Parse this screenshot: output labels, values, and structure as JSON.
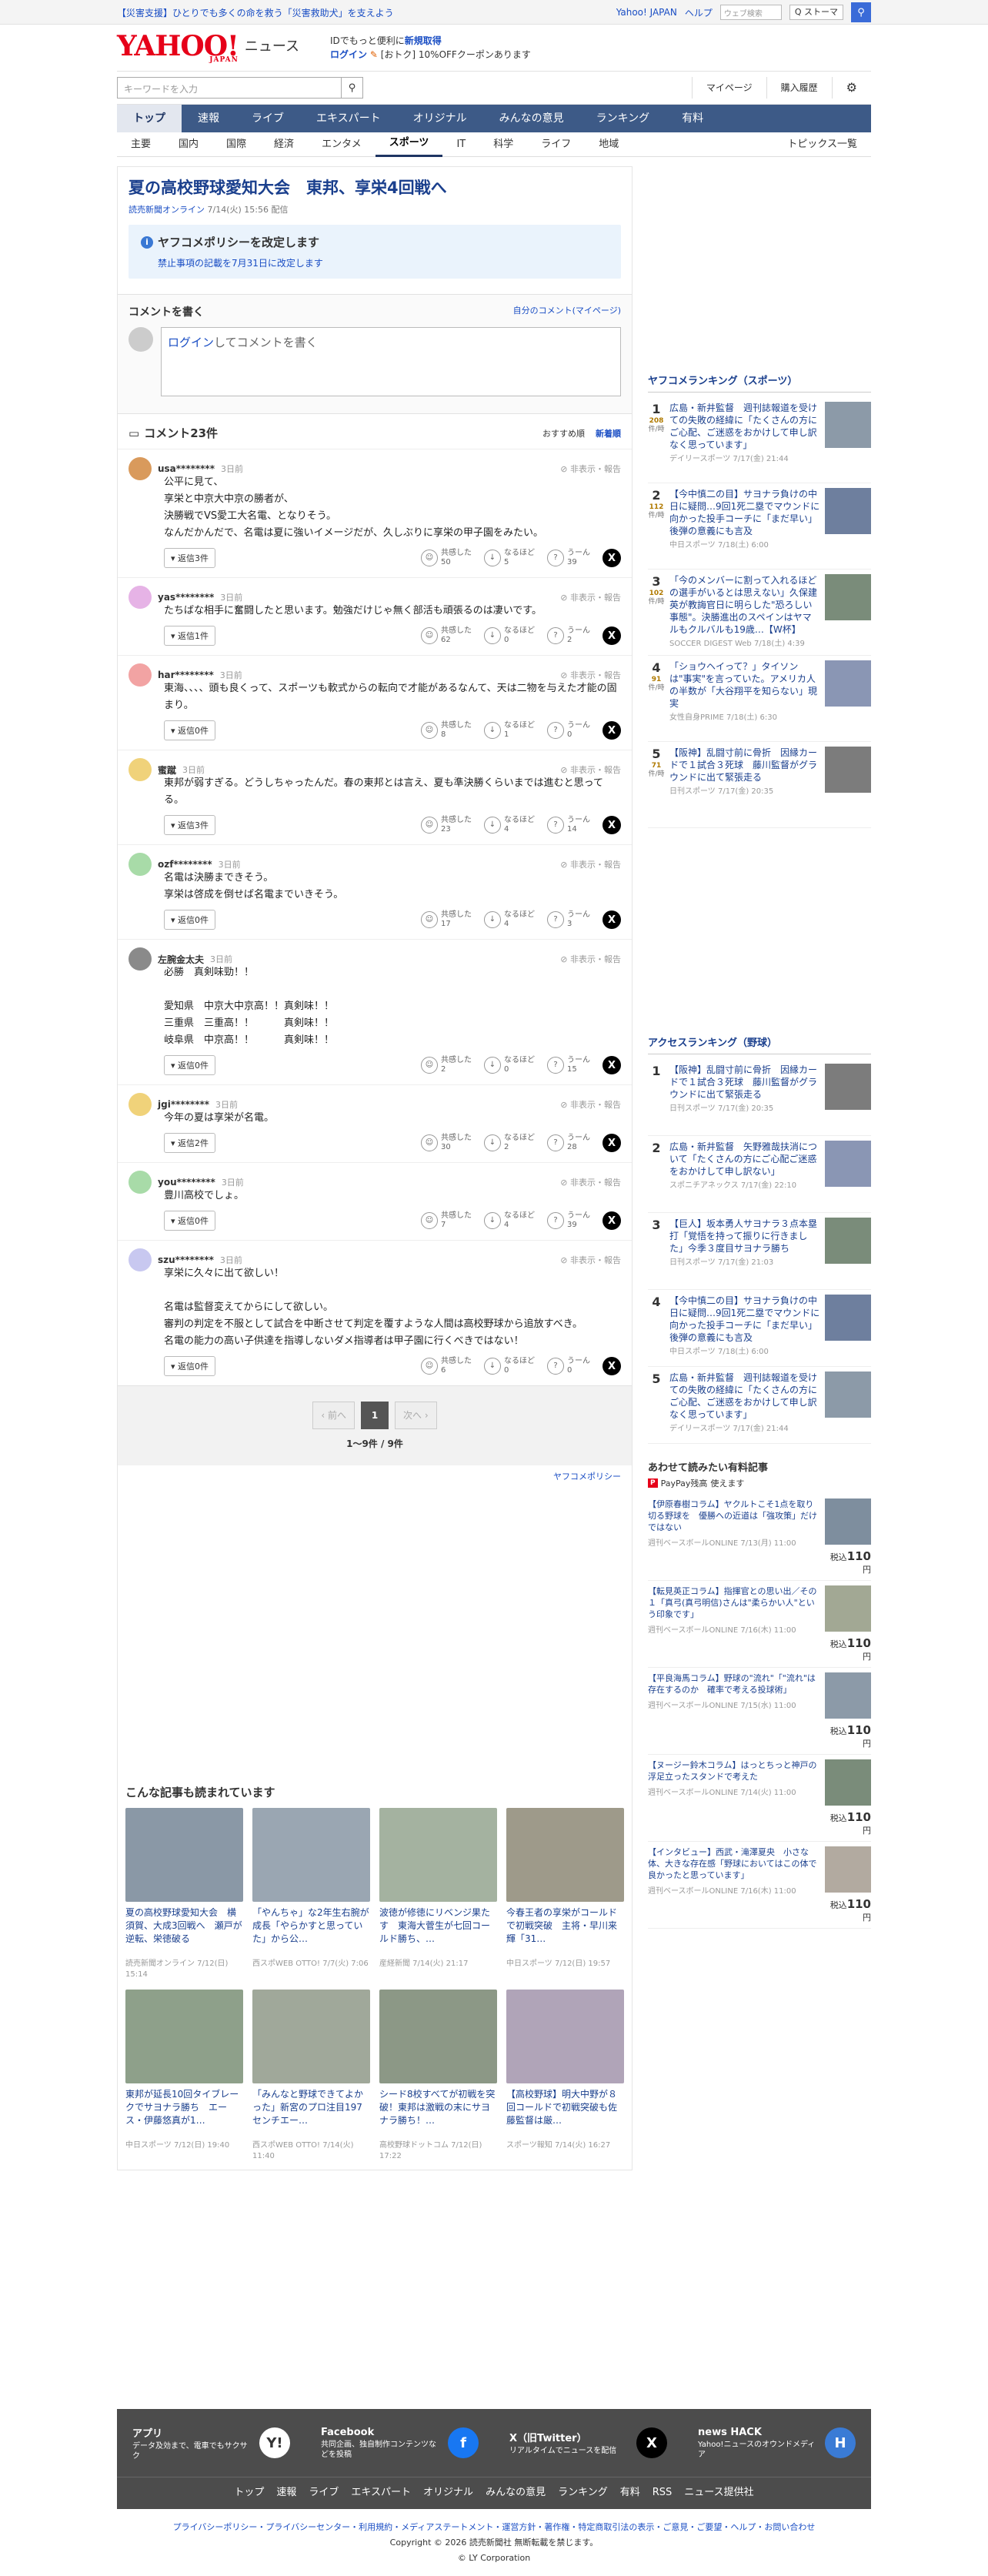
{
  "topbar": {
    "alert": "【災害支援】ひとりでも多くの命を救う「災害救助犬」を支えよう",
    "yahoo_japan": "Yahoo! JAPAN",
    "help": "ヘルプ",
    "search_placeholder": "ウェブ検索",
    "search_btn": "Q ストーマ"
  },
  "header": {
    "logo": "YAHOO!",
    "logo_sub": "JAPAN",
    "service": "ニュース",
    "promo1": "IDでもっと便利に",
    "promo1_link": "新規取得",
    "promo2_login": "ログイン",
    "promo2": "[おトク] 10%OFFクーポンあります"
  },
  "search": {
    "placeholder": "キーワードを入力",
    "mypage": "マイページ",
    "buy": "購入履歴"
  },
  "gnav": [
    "トップ",
    "速報",
    "ライブ",
    "エキスパート",
    "オリジナル",
    "みんなの意見",
    "ランキング",
    "有料"
  ],
  "snav": [
    "主要",
    "国内",
    "国際",
    "経済",
    "エンタメ",
    "スポーツ",
    "IT",
    "科学",
    "ライフ",
    "地域"
  ],
  "topics": "トピックス一覧",
  "article": {
    "title": "夏の高校野球愛知大会　東邦、享栄4回戦へ",
    "source": "読売新聞オンライン",
    "date": "7/14(火) 15:56 配信"
  },
  "notice": {
    "title": "ヤフコメポリシーを改定します",
    "text": "禁止事項の記載を7月31日に改定します"
  },
  "write": {
    "title": "コメントを書く",
    "mine": "自分のコメント(マイページ)",
    "login": "ログイン",
    "placeholder": "してコメントを書く"
  },
  "comments_head": {
    "title": "コメント23件",
    "sort1": "おすすめ順",
    "sort2": "新着順"
  },
  "comments": [
    {
      "user": "usa********",
      "time": "3日前",
      "report": "非表示・報告",
      "text": "公平に見て、\n享栄と中京大中京の勝者が、\n決勝戦でVS愛工大名電、となりそう。\nなんだかんだで、名電は夏に強いイメージだが、久しぶりに享栄の甲子園をみたい。",
      "replies": "返信3件",
      "r1l": "共感した",
      "r1": "50",
      "r2l": "なるほど",
      "r2": "5",
      "r3l": "うーん",
      "r3": "39"
    },
    {
      "user": "yas********",
      "time": "3日前",
      "report": "非表示・報告",
      "text": "たちばな相手に奮闘したと思います。勉強だけじゃ無く部活も頑張るのは凄いです。",
      "replies": "返信1件",
      "r1l": "共感した",
      "r1": "62",
      "r2l": "なるほど",
      "r2": "0",
      "r3l": "うーん",
      "r3": "2"
    },
    {
      "user": "har********",
      "time": "3日前",
      "report": "非表示・報告",
      "text": "東海、、、、頭も良くって、スポーツも軟式からの転向で才能があるなんて、天は二物を与えた才能の固まり。",
      "replies": "返信0件",
      "r1l": "共感した",
      "r1": "8",
      "r2l": "なるほど",
      "r2": "1",
      "r3l": "うーん",
      "r3": "0"
    },
    {
      "user": "蜜蹴",
      "time": "3日前",
      "report": "非表示・報告",
      "text": "東邦が弱すぎる。どうしちゃったんだ。春の東邦とは言え、夏も準決勝くらいまでは進むと思ってる。",
      "replies": "返信3件",
      "r1l": "共感した",
      "r1": "23",
      "r2l": "なるほど",
      "r2": "4",
      "r3l": "うーん",
      "r3": "14"
    },
    {
      "user": "ozf********",
      "time": "3日前",
      "report": "非表示・報告",
      "text": "名電は決勝まできそう。\n享栄は啓成を倒せば名電までいきそう。",
      "replies": "返信0件",
      "r1l": "共感した",
      "r1": "17",
      "r2l": "なるほど",
      "r2": "4",
      "r3l": "うーん",
      "r3": "3"
    },
    {
      "user": "左腕金太夫",
      "time": "3日前",
      "report": "非表示・報告",
      "text": "必勝　真剣味勁！！\n\n愛知県　中京大中京高！！真剣味！！\n三重県　三重高！！　　　真剣味！！\n岐阜県　中京高！！　　　真剣味！！",
      "replies": "返信0件",
      "r1l": "共感した",
      "r1": "2",
      "r2l": "なるほど",
      "r2": "0",
      "r3l": "うーん",
      "r3": "15"
    },
    {
      "user": "jgi********",
      "time": "3日前",
      "report": "非表示・報告",
      "text": "今年の夏は享栄が名電。",
      "replies": "返信2件",
      "r1l": "共感した",
      "r1": "30",
      "r2l": "なるほど",
      "r2": "2",
      "r3l": "うーん",
      "r3": "28"
    },
    {
      "user": "you********",
      "time": "3日前",
      "report": "非表示・報告",
      "text": "豊川高校でしょ。",
      "replies": "返信0件",
      "r1l": "共感した",
      "r1": "7",
      "r2l": "なるほど",
      "r2": "4",
      "r3l": "うーん",
      "r3": "39"
    },
    {
      "user": "szu********",
      "time": "3日前",
      "report": "非表示・報告",
      "text": "享栄に久々に出て欲しい！\n\n名電は監督変えてからにして欲しい。\n審判の判定を不服として試合を中断させて判定を覆すような人間は高校野球から追放すべき。\n名電の能力の高い子供達を指導しないダメ指導者は甲子園に行くべきではない！",
      "replies": "返信0件",
      "r1l": "共感した",
      "r1": "6",
      "r2l": "なるほど",
      "r2": "0",
      "r3l": "うーん",
      "r3": "0"
    }
  ],
  "pager": {
    "prev": "前へ",
    "cur": "1",
    "next": "次へ",
    "count": "1〜9件 / 9件"
  },
  "policy": "ヤフコメポリシー",
  "reco": {
    "title": "こんな記事も読まれています",
    "items": [
      {
        "t": "夏の高校野球愛知大会　横須賀、大成3回戦へ　瀬戸が逆転、栄徳破る",
        "s": "読売新聞オンライン 7/12(日) 15:14"
      },
      {
        "t": "「やんちゃ」な2年生右腕が成長「やらかすと思っていた」から公…",
        "s": "西スポWEB OTTO! 7/7(火) 7:06"
      },
      {
        "t": "波徳が修徳にリベンジ果たす　東海大菅生が七回コールド勝ち、…",
        "s": "産経新聞 7/14(火) 21:17"
      },
      {
        "t": "今春王者の享栄がコールドで初戦突破　主将・早川来輝「31…",
        "s": "中日スポーツ 7/12(日) 19:57"
      },
      {
        "t": "東邦が延長10回タイブレークでサヨナラ勝ち　エース・伊藤悠真が1…",
        "s": "中日スポーツ 7/12(日) 19:40"
      },
      {
        "t": "「みんなと野球できてよかった」新宮のプロ注目197センチエー…",
        "s": "西スポWEB OTTO! 7/14(火) 11:40"
      },
      {
        "t": "シード8校すべてが初戦を突破！東邦は激戦の末にサヨナラ勝ち！…",
        "s": "高校野球ドットコム 7/12(日) 17:22"
      },
      {
        "t": "【高校野球】明大中野が８回コールドで初戦突破も佐藤監督は厳…",
        "s": "スポーツ報知 7/14(火) 16:27"
      }
    ]
  },
  "ranking1": {
    "title": "ヤフコメランキング（スポーツ）",
    "items": [
      {
        "n": "1",
        "c": "208",
        "u": "件/時",
        "t": "広島・新井監督　週刊誌報道を受けての失敗の経緯に「たくさんの方にご心配、ご迷惑をおかけして申し訳なく思っています」",
        "s": "デイリースポーツ 7/17(金) 21:44"
      },
      {
        "n": "2",
        "c": "112",
        "u": "件/時",
        "t": "【今中慎二の目】サヨナラ負けの中日に疑問…9回1死二塁でマウンドに向かった投手コーチに「まだ早い」後弾の意義にも言及",
        "s": "中日スポーツ 7/18(土) 6:00"
      },
      {
        "n": "3",
        "c": "102",
        "u": "件/時",
        "t": "「今のメンバーに割って入れるほどの選手がいるとは思えない」久保建英が教誨官日に明らした\"恐ろしい事態\"。決勝進出のスペインはヤマルもクルバルも19歳…【W杯】",
        "s": "SOCCER DIGEST Web 7/18(土) 4:39"
      },
      {
        "n": "4",
        "c": "91",
        "u": "件/時",
        "t": "「ショウヘイって？」タイソンは\"事実\"を言っていた。アメリカ人の半数が「大谷翔平を知らない」現実",
        "s": "女性自身PRIME 7/18(土) 6:30"
      },
      {
        "n": "5",
        "c": "71",
        "u": "件/時",
        "t": "【阪神】乱闘寸前に骨折　因縁カードで１試合３死球　藤川監督がグラウンドに出て緊張走る",
        "s": "日刊スポーツ 7/17(金) 20:35"
      }
    ]
  },
  "ranking2": {
    "title": "アクセスランキング（野球）",
    "items": [
      {
        "n": "1",
        "t": "【阪神】乱闘寸前に骨折　因縁カードで１試合３死球　藤川監督がグラウンドに出て緊張走る",
        "s": "日刊スポーツ 7/17(金) 20:35"
      },
      {
        "n": "2",
        "t": "広島・新井監督　矢野雅哉扶消について「たくさんの方にご心配ご迷惑をおかけして申し訳ない」",
        "s": "スポニチアネックス 7/17(金) 22:10"
      },
      {
        "n": "3",
        "t": "【巨人】坂本勇人サヨナラ３点本塁打「覚悟を持って振りに行きました」今季３度目サヨナラ勝ち",
        "s": "日刊スポーツ 7/17(金) 21:03"
      },
      {
        "n": "4",
        "t": "【今中慎二の目】サヨナラ負けの中日に疑問…9回1死二塁でマウンドに向かった投手コーチに「まだ早い」後弾の意義にも言及",
        "s": "中日スポーツ 7/18(土) 6:00"
      },
      {
        "n": "5",
        "t": "広島・新井監督　週刊誌報道を受けての失敗の経緯に「たくさんの方にご心配、ご迷惑をおかけして申し訳なく思っています」",
        "s": "デイリースポーツ 7/17(金) 21:44"
      }
    ]
  },
  "paid": {
    "title": "あわせて読みたい有料記事",
    "pp": "PayPay残高",
    "pp_suffix": "使えます",
    "items": [
      {
        "t": "【伊原春樹コラム】ヤクルトこそ1点を取り切る野球を　優勝への近道は「強攻策」だけではない",
        "s": "週刊ベースボールONLINE 7/13(月) 11:00",
        "p": "110"
      },
      {
        "t": "【転見英正コラム】指揮官との思い出／その１「真弓(真弓明信)さんは\"柔らかい人\"という印象です」",
        "s": "週刊ベースボールONLINE 7/16(木) 11:00",
        "p": "110"
      },
      {
        "t": "【平良海馬コラム】野球の\"流れ\"「\"流れ\"は存在するのか　確率で考える投球術」",
        "s": "週刊ベースボールONLINE 7/15(水) 11:00",
        "p": "110"
      },
      {
        "t": "【ヌージー鈴木コラム】はっとちっと神戸の浮足立ったスタンドで考えた",
        "s": "週刊ベースボールONLINE 7/14(火) 11:00",
        "p": "110"
      },
      {
        "t": "【インタビュー】西武・滝澤夏央　小さな体、大きな存在感「野球においてはこの体で良かったと思っています」",
        "s": "週刊ベースボールONLINE 7/16(木) 11:00",
        "p": "110"
      }
    ],
    "tax": "税込",
    "yen": "円"
  },
  "footer": {
    "svcs": [
      {
        "h": "アプリ",
        "p": "データ及効まで、電車でもサクサク",
        "i": "Y!"
      },
      {
        "h": "Facebook",
        "p": "共同企画、独自制作コンテンツなどを投稿",
        "i": "f"
      },
      {
        "h": "X（旧Twitter）",
        "p": "リアルタイムでニュースを配信",
        "i": "X"
      },
      {
        "h": "news HACK",
        "p": "Yahoo!ニュースのオウンドメディア",
        "i": "H"
      }
    ],
    "nav": [
      "トップ",
      "速報",
      "ライブ",
      "エキスパート",
      "オリジナル",
      "みんなの意見",
      "ランキング",
      "有料",
      "RSS",
      "ニュース提供社"
    ],
    "links": "プライバシーポリシー・プライバシーセンター・利用規約・メディアステートメント・運営方針・著作権・特定商取引法の表示・ご意見・ご要望・ヘルプ・お問い合わせ",
    "copy1": "Copyright © 2026 読売新聞社 無断転載を禁じます。",
    "copy2": "© LY Corporation"
  },
  "colors": {
    "nav": "#3d5a87",
    "title": "#1a3f8d",
    "link": "#1a4ec4",
    "logo": "#e60019"
  }
}
